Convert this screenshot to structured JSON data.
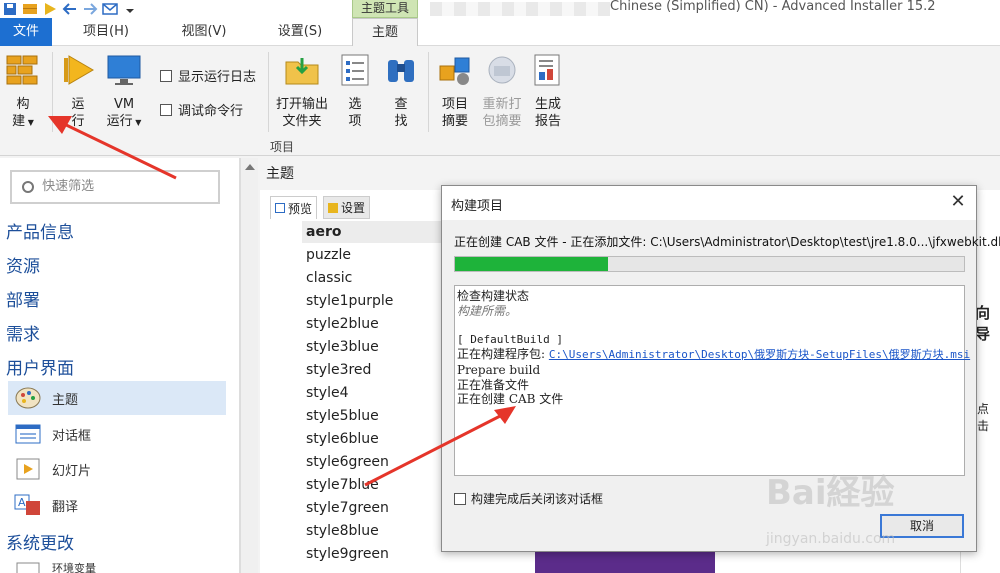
{
  "window": {
    "title": "Chinese (Simplified) CN) - Advanced Installer 15.2",
    "context_tab_group": "主题工具"
  },
  "tabs": [
    {
      "label": "文件",
      "active": true
    },
    {
      "label": "项目(H)"
    },
    {
      "label": "视图(V)"
    },
    {
      "label": "设置(S)"
    },
    {
      "label": "主题"
    }
  ],
  "ribbon": {
    "build": {
      "line1": "构",
      "line2": "建"
    },
    "run": {
      "line1": "运",
      "line2": "行"
    },
    "vm_run": {
      "line1": "VM",
      "line2": "运行"
    },
    "show_log": "显示运行日志",
    "debug_cmd": "调试命令行",
    "open_output": {
      "line1": "打开输出",
      "line2": "文件夹"
    },
    "options": {
      "line1": "选",
      "line2": "项"
    },
    "find": {
      "line1": "查",
      "line2": "找"
    },
    "project_summary": {
      "line1": "项目",
      "line2": "摘要"
    },
    "repack_summary": {
      "line1": "重新打",
      "line2": "包摘要"
    },
    "gen_report": {
      "line1": "生成",
      "line2": "报告"
    },
    "group_label": "项目"
  },
  "left": {
    "filter_placeholder": "快速筛选",
    "sections": {
      "product_info": "产品信息",
      "resources": "资源",
      "deploy": "部署",
      "requirements": "需求",
      "ui": "用户界面",
      "system_changes": "系统更改"
    },
    "ui_items": [
      {
        "label": "主题",
        "icon": "palette-icon",
        "selected": true
      },
      {
        "label": "对话框",
        "icon": "dialog-icon"
      },
      {
        "label": "幻灯片",
        "icon": "slideshow-icon"
      },
      {
        "label": "翻译",
        "icon": "translate-icon"
      }
    ],
    "partial_item": "环境变量"
  },
  "main": {
    "header": "主题",
    "subtabs": [
      "预览",
      "设置"
    ],
    "themes": [
      "aero",
      "puzzle",
      "classic",
      "style1purple",
      "style2blue",
      "style3blue",
      "style3red",
      "style4",
      "style5blue",
      "style6blue",
      "style6green",
      "style7blue",
      "style7green",
      "style8blue",
      "style9green"
    ],
    "selected_theme": "aero",
    "fragment_right1": "向导",
    "fragment_right2": "点击"
  },
  "dialog": {
    "title": "构建项目",
    "close": "✕",
    "status": "正在创建 CAB 文件 - 正在添加文件: C:\\Users\\Administrator\\Desktop\\test\\jre1.8.0...\\jfxwebkit.dll",
    "progress": 0.3,
    "log": {
      "l1": "检查构建状态",
      "l2": "构建所需。",
      "l3": "[ DefaultBuild ]",
      "l4_prefix": "正在构建程序包: ",
      "l4_path": "C:\\Users\\Administrator\\Desktop\\俄罗斯方块-SetupFiles\\俄罗斯方块.msi",
      "l5": "Prepare build",
      "l6": "正在准备文件",
      "l7": "正在创建 CAB 文件"
    },
    "close_after": "构建完成后关闭该对话框",
    "cancel": "取消"
  },
  "watermark": {
    "text": "Bai経验",
    "url_text": "jingyan.baidu.com"
  },
  "colors": {
    "accent": "#1d6fd1",
    "progress": "#1eb33a",
    "arrow": "#e5352a",
    "section": "#1d4f9a"
  }
}
